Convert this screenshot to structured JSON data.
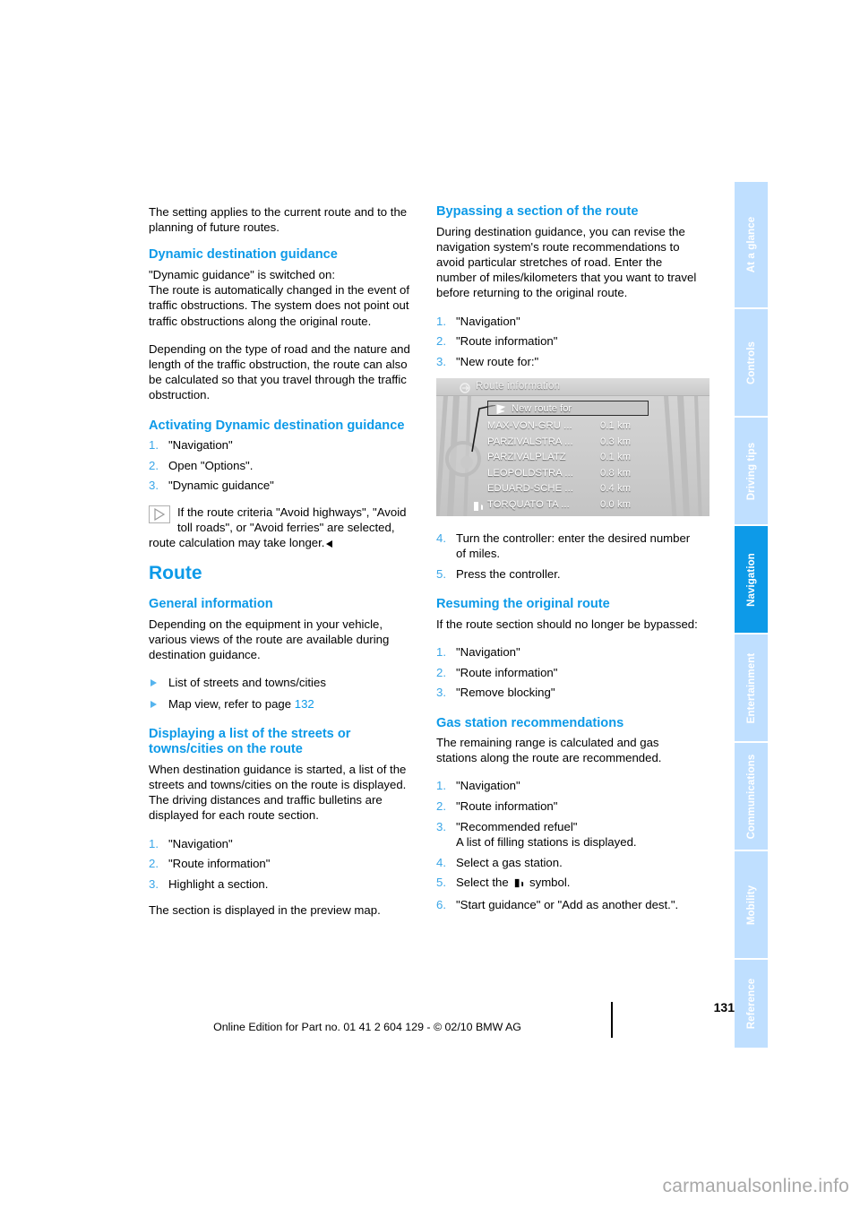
{
  "document": {
    "page_number": "131",
    "imprint": "Online Edition for Part no. 01 41 2 604 129 - © 02/10 BMW AG",
    "watermark": "carmanualsonline.info",
    "accent_color": "#0d9ae8",
    "tab_inactive_color": "#bfdfff"
  },
  "sidebar": {
    "tabs": [
      {
        "label": "At a glance",
        "active": false
      },
      {
        "label": "Controls",
        "active": false
      },
      {
        "label": "Driving tips",
        "active": false
      },
      {
        "label": "Navigation",
        "active": true
      },
      {
        "label": "Entertainment",
        "active": false
      },
      {
        "label": "Communications",
        "active": false
      },
      {
        "label": "Mobility",
        "active": false
      },
      {
        "label": "Reference",
        "active": false
      }
    ]
  },
  "left_column": {
    "intro": "The setting applies to the current route and to the planning of future routes.",
    "dynamic_guidance": {
      "heading": "Dynamic destination guidance",
      "para1": "\"Dynamic guidance\" is switched on:\nThe route is automatically changed in the event of traffic obstructions. The system does not point out traffic obstructions along the original route.",
      "para2": "Depending on the type of road and the nature and length of the traffic obstruction, the route can also be calculated so that you travel through the traffic obstruction."
    },
    "activating": {
      "heading": "Activating Dynamic destination guidance",
      "steps": [
        "\"Navigation\"",
        "Open \"Options\".",
        "\"Dynamic guidance\""
      ],
      "note": "If the route criteria \"Avoid highways\", \"Avoid toll roads\", or \"Avoid ferries\" are selected, route calculation may take longer."
    },
    "route": {
      "heading": "Route",
      "general": {
        "heading": "General information",
        "para": "Depending on the equipment in your vehicle, various views of the route are available during destination guidance.",
        "bullets": [
          {
            "text": "List of streets and towns/cities",
            "page_ref": ""
          },
          {
            "text": "Map view, refer to page ",
            "page_ref": "132"
          }
        ]
      },
      "displaying_list": {
        "heading": "Displaying a list of the streets or towns/cities on the route",
        "para": "When destination guidance is started, a list of the streets and towns/cities on the route is displayed. The driving distances and traffic bulletins are displayed for each route section.",
        "steps": [
          "\"Navigation\"",
          "\"Route information\"",
          "Highlight a section."
        ],
        "closing": "The section is displayed in the preview map."
      }
    }
  },
  "right_column": {
    "bypassing": {
      "heading": "Bypassing a section of the route",
      "para": "During destination guidance, you can revise the navigation system's route recommendations to avoid particular stretches of road. Enter the number of miles/kilometers that you want to travel before returning to the original route.",
      "steps_before": [
        "\"Navigation\"",
        "\"Route information\"",
        "\"New route for:\""
      ],
      "steps_after": [
        "Turn the controller: enter the desired number of miles.",
        "Press the controller."
      ]
    },
    "nav_screen": {
      "header_title": "Route information",
      "header_icon": "route-info-icon",
      "highlight_label": "New route for",
      "highlight_icon": "flag-icon",
      "rows": [
        {
          "name": "MAX-VON-GRU ...",
          "distance": "0.1 km",
          "icon": ""
        },
        {
          "name": "PARZIVALSTRA ...",
          "distance": "0.3 km",
          "icon": ""
        },
        {
          "name": "PARZIVALPLATZ",
          "distance": "0.1 km",
          "icon": ""
        },
        {
          "name": "LEOPOLDSTRA ...",
          "distance": "0.8 km",
          "icon": ""
        },
        {
          "name": "EDUARD-SCHE ...",
          "distance": "0.4 km",
          "icon": ""
        },
        {
          "name": "TORQUATO TA ...",
          "distance": "0.0 km",
          "icon": "gas-pump-icon"
        }
      ]
    },
    "resuming": {
      "heading": "Resuming the original route",
      "para": "If the route section should no longer be bypassed:",
      "steps": [
        "\"Navigation\"",
        "\"Route information\"",
        "\"Remove blocking\""
      ]
    },
    "gas_station": {
      "heading": "Gas station recommendations",
      "para": "The remaining range is calculated and gas stations along the route are recommended.",
      "steps": [
        {
          "text": "\"Navigation\"",
          "sub": ""
        },
        {
          "text": "\"Route information\"",
          "sub": ""
        },
        {
          "text": "\"Recommended refuel\"",
          "sub": "A list of filling stations is displayed."
        },
        {
          "text": "Select a gas station.",
          "sub": ""
        },
        {
          "text": "Select the  symbol.",
          "sub": ""
        },
        {
          "text": "\"Start guidance\" or \"Add as another dest.\".",
          "sub": ""
        }
      ],
      "step5_prefix": "Select the",
      "step5_suffix": "symbol."
    }
  }
}
